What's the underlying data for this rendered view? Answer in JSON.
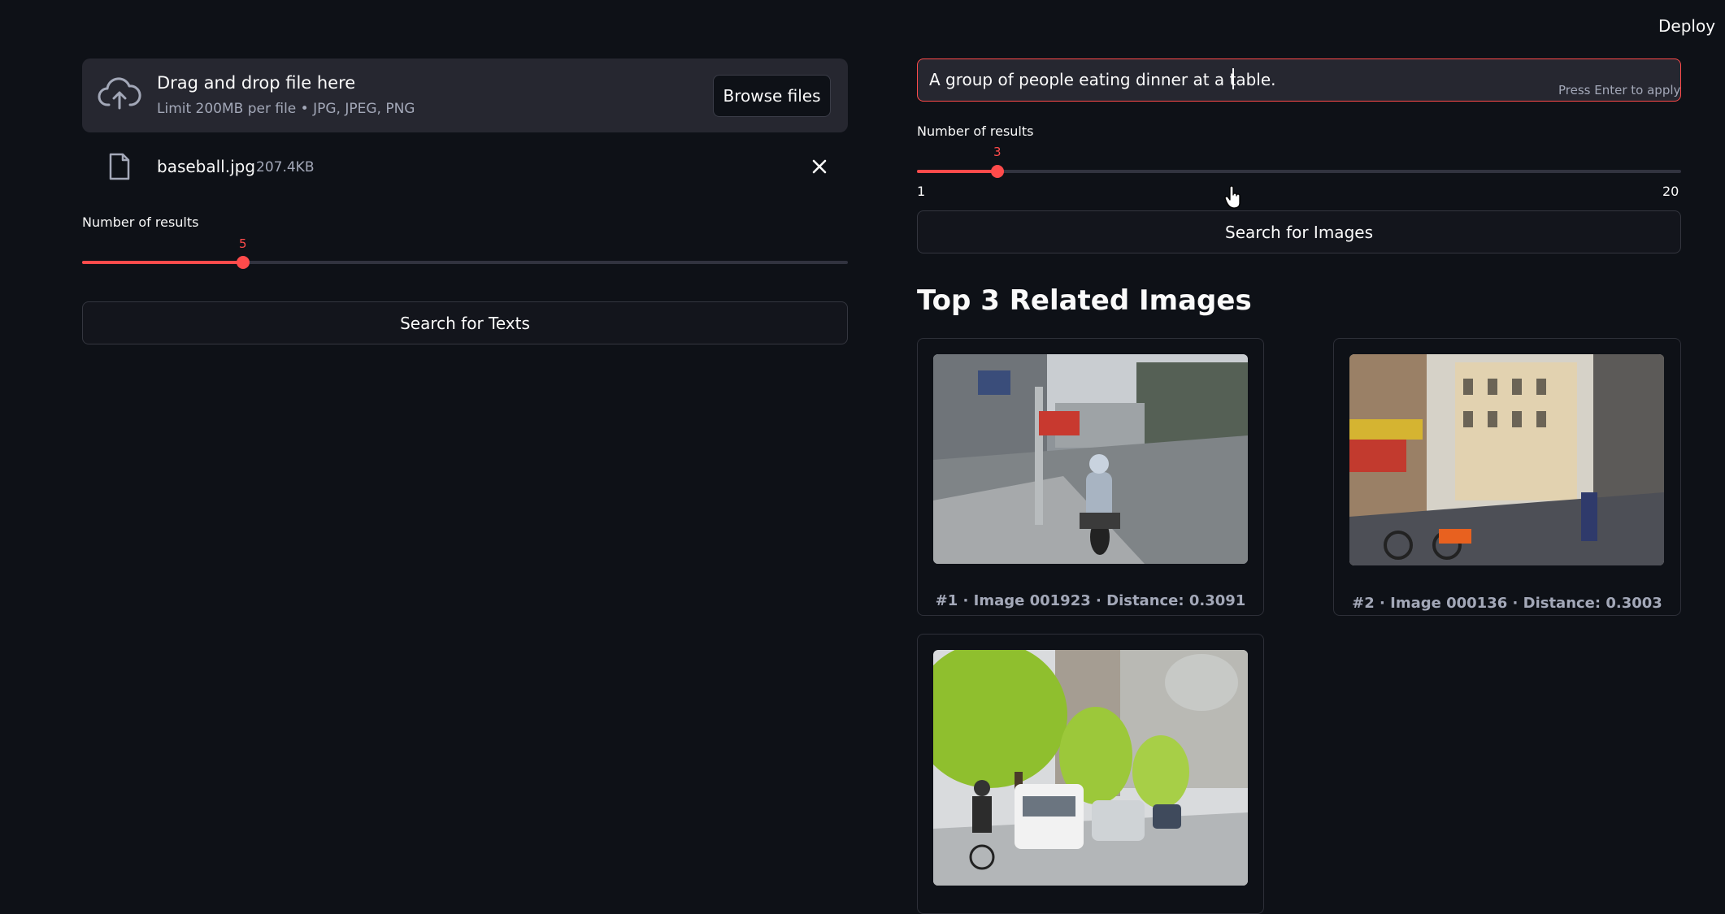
{
  "header": {
    "deploy_label": "Deploy"
  },
  "uploader": {
    "title": "Drag and drop file here",
    "subtitle": "Limit 200MB per file • JPG, JPEG, PNG",
    "browse_label": "Browse files",
    "file_name": "baseball.jpg",
    "file_size": "207.4KB"
  },
  "text_search": {
    "slider_label": "Number of results",
    "slider_value": "5",
    "slider_fraction": 0.2105,
    "button_label": "Search for Texts"
  },
  "image_search": {
    "query_value": "A group of people eating dinner at a table.",
    "input_hint": "Press Enter to apply",
    "slider_label": "Number of results",
    "slider_value": "3",
    "slider_min": "1",
    "slider_max": "20",
    "slider_fraction": 0.1053,
    "button_label": "Search for Images"
  },
  "results": {
    "title": "Top 3 Related Images",
    "items": [
      {
        "caption": "#1 · Image 001923 · Distance: 0.3091",
        "scene": "street-motorcycle"
      },
      {
        "caption": "#2 · Image 000136 · Distance: 0.3003",
        "scene": "paris-street-bikes"
      },
      {
        "caption": "",
        "scene": "tree-lined-street-traffic"
      }
    ]
  },
  "colors": {
    "background": "#0e1117",
    "accent": "#ff4b4b",
    "surface": "#262730"
  }
}
